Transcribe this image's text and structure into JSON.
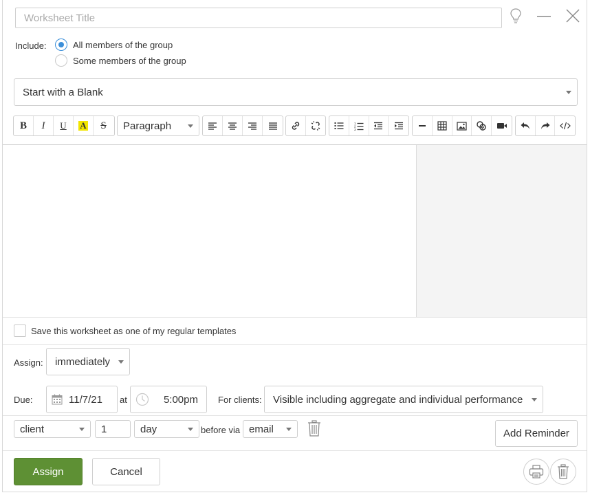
{
  "title_field": {
    "value": "",
    "placeholder": "Worksheet Title"
  },
  "window_icons": [
    "lightbulb-icon",
    "minimize-icon",
    "close-icon"
  ],
  "include": {
    "label": "Include:",
    "options": [
      {
        "label": "All members of the group",
        "selected": true
      },
      {
        "label": "Some members of the group",
        "selected": false
      }
    ]
  },
  "template_select": {
    "value": "Start with a Blank"
  },
  "toolbar": {
    "bold": "B",
    "italic": "I",
    "underline": "U",
    "highlight": "A",
    "strike": "S",
    "block_format": "Paragraph"
  },
  "save_template": {
    "label": "Save this worksheet as one of my regular templates",
    "checked": false
  },
  "assign": {
    "label": "Assign:",
    "value": "immediately"
  },
  "due": {
    "label": "Due:",
    "date": "11/7/21",
    "at_label": "at",
    "time": "5:00pm"
  },
  "for_clients": {
    "label": "For clients:",
    "value": "Visible including aggregate and individual performance"
  },
  "reminder": {
    "recipient": "client",
    "amount": "1",
    "unit": "day",
    "before_via_label": "before via",
    "channel": "email",
    "add_label": "Add Reminder"
  },
  "footer": {
    "assign_label": "Assign",
    "cancel_label": "Cancel"
  },
  "colors": {
    "accent": "#3b8fd9",
    "primary_button": "#5e9034",
    "highlight": "#f2e500"
  }
}
